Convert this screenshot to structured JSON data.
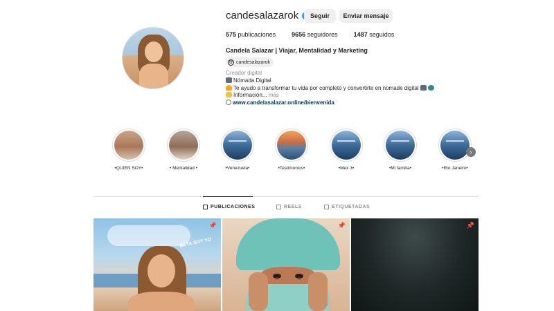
{
  "profile": {
    "username": "candesalazarok",
    "follow_label": "Seguir",
    "message_label": "Enviar mensaje",
    "stats": {
      "posts_count": "575",
      "posts_label": "publicaciones",
      "followers_count": "9656",
      "followers_label": "seguidores",
      "following_count": "1487",
      "following_label": "seguidos"
    },
    "full_name": "Candela Salazar | Viajar, Mentalidad y Marketing",
    "threads_handle": "candesalazarok",
    "category": "Creador digital",
    "bio_line1": "Nómada Digital",
    "bio_line2": "Te ayudo a transformar tu vida por completo y convertirte en nomade digital",
    "bio_line3": "Información... ",
    "bio_more": "más",
    "website": "www.candelasalazar.online/bienvenida"
  },
  "highlights": [
    {
      "label": "•QUIEN SOY•"
    },
    {
      "label": "• Mentalidad •"
    },
    {
      "label": "•Venezuela•"
    },
    {
      "label": "•Testimonios•"
    },
    {
      "label": "•Mex 3•"
    },
    {
      "label": "•Mi familia•"
    },
    {
      "label": "•Rio Janeiro•"
    }
  ],
  "tabs": [
    {
      "label": "PUBLICACIONES",
      "active": true
    },
    {
      "label": "REELS",
      "active": false
    },
    {
      "label": "ETIQUETADAS",
      "active": false
    }
  ],
  "posts": [
    {
      "overlay_text": "BETA SOY YO"
    }
  ],
  "colors": {
    "link": "#00376b",
    "verified": "#3897f0",
    "button_bg": "#efefef"
  }
}
